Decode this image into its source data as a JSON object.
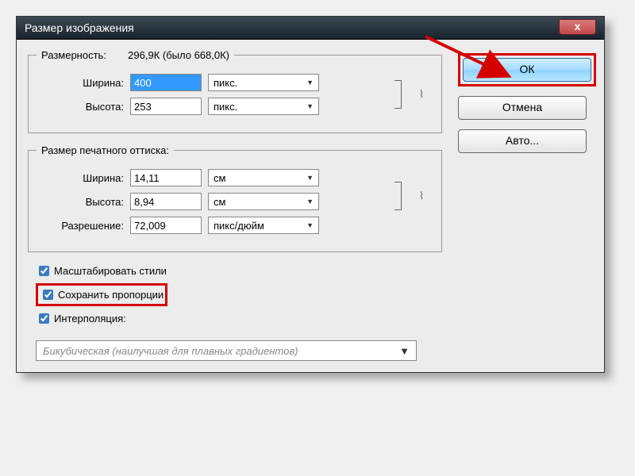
{
  "title": "Размер изображения",
  "close": "x",
  "dimensions": {
    "legend": "Размерность:",
    "size": "296,9К (было 668,0К)",
    "width_label": "Ширина:",
    "width_value": "400",
    "height_label": "Высота:",
    "height_value": "253",
    "unit": "пикс.",
    "link_icon": "⎘"
  },
  "print": {
    "legend": "Размер печатного оттиска:",
    "width_label": "Ширина:",
    "width_value": "14,11",
    "height_label": "Высота:",
    "height_value": "8,94",
    "unit": "см",
    "res_label": "Разрешение:",
    "res_value": "72,009",
    "res_unit": "пикс/дюйм",
    "link_icon": "⎘"
  },
  "checks": {
    "scale_styles": "Масштабировать стили",
    "constrain": "Сохранить пропорции",
    "interp": "Интерполяция:"
  },
  "interp_combo": "Бикубическая (наилучшая для плавных градиентов)",
  "buttons": {
    "ok": "ОК",
    "cancel": "Отмена",
    "auto": "Авто..."
  }
}
